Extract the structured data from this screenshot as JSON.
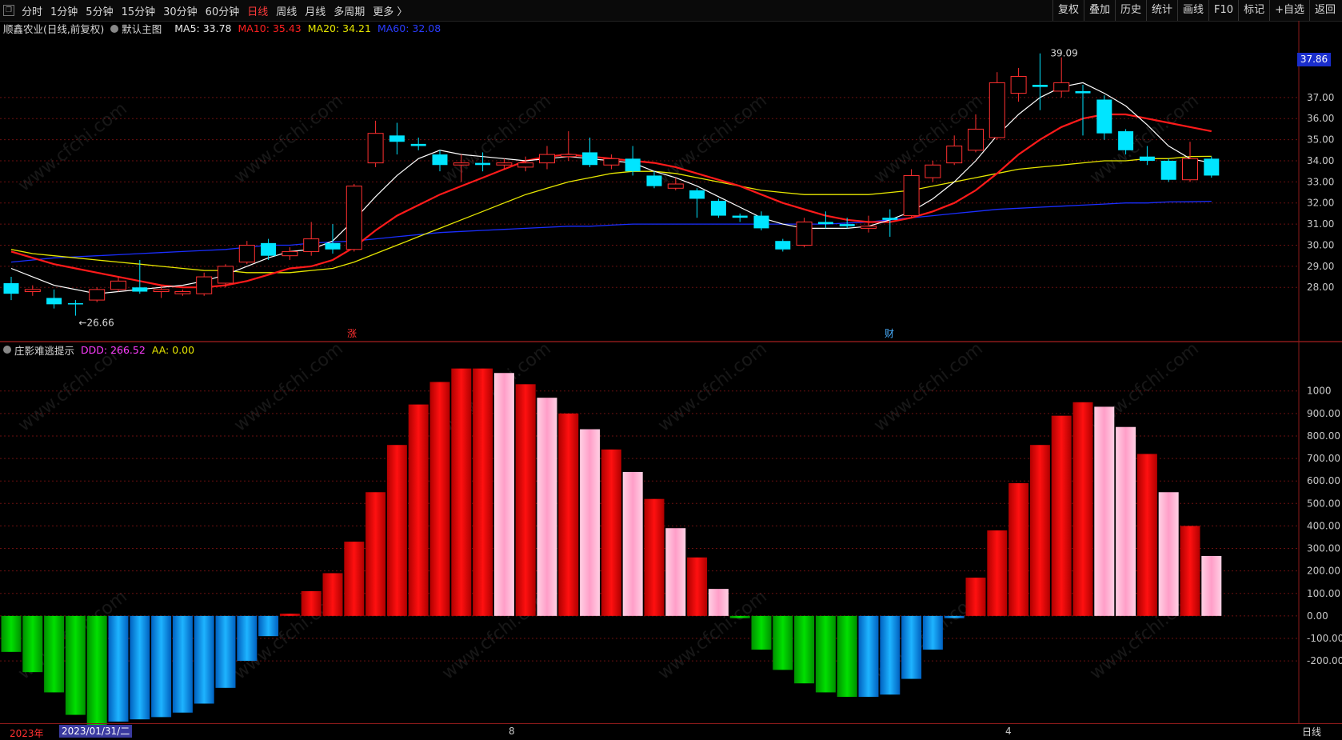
{
  "toolbar": {
    "window_icon": "restore-icon",
    "periods": [
      "分时",
      "1分钟",
      "5分钟",
      "15分钟",
      "30分钟",
      "60分钟",
      "日线",
      "周线",
      "月线",
      "多周期",
      "更多 〉"
    ],
    "active_period": "日线",
    "actions": [
      "复权",
      "叠加",
      "历史",
      "统计",
      "画线",
      "F10",
      "标记",
      "+自选",
      "返回"
    ]
  },
  "main_header": {
    "stock": "顺鑫农业(日线,前复权)",
    "template": "默认主图",
    "ma5": "MA5: 33.78",
    "ma10": "MA10: 35.43",
    "ma20": "MA20: 34.21",
    "ma60": "MA60: 32.08"
  },
  "indicator_header": {
    "name": "庄影难逃提示",
    "ddd": "DDD: 266.52",
    "aa": "AA: 0.00"
  },
  "current_price": "37.86",
  "annotations": {
    "high": "39.09",
    "low": "←26.66",
    "zhang": "涨",
    "cai": "财"
  },
  "bottom": {
    "year": "2023年",
    "date": "2023/01/31/二",
    "month8": "8",
    "month4": "4",
    "period_label": "日线"
  },
  "watermark": "www.cfchi.com",
  "colors": {
    "up": "#ff3030",
    "down": "#00e5ff",
    "ma5": "#ffffff",
    "ma10": "#ff1a1a",
    "ma20": "#e6e600",
    "ma60": "#1a2eff",
    "grid": "#6b1010",
    "bar_red": "#ff1010",
    "bar_pink": "#ff9ec8",
    "bar_green": "#00e000",
    "bar_blue": "#1eb4ff"
  },
  "chart_data": [
    {
      "type": "candlestick",
      "title": "顺鑫农业(日线,前复权)",
      "y_ticks": [
        "28.00",
        "29.00",
        "30.00",
        "31.00",
        "32.00",
        "33.00",
        "34.00",
        "35.00",
        "36.00",
        "37.00"
      ],
      "ylim": [
        26.0,
        39.8
      ],
      "candles": [
        {
          "o": 28.2,
          "c": 27.7,
          "h": 28.5,
          "l": 27.4
        },
        {
          "o": 27.8,
          "c": 27.9,
          "h": 28.1,
          "l": 27.6
        },
        {
          "o": 27.5,
          "c": 27.2,
          "h": 27.9,
          "l": 27.0
        },
        {
          "o": 27.25,
          "c": 27.2,
          "h": 27.4,
          "l": 26.66
        },
        {
          "o": 27.4,
          "c": 27.9,
          "h": 28.0,
          "l": 27.3
        },
        {
          "o": 27.9,
          "c": 28.3,
          "h": 28.5,
          "l": 27.8
        },
        {
          "o": 28.0,
          "c": 27.8,
          "h": 29.3,
          "l": 27.7
        },
        {
          "o": 27.8,
          "c": 27.9,
          "h": 28.1,
          "l": 27.5
        },
        {
          "o": 27.7,
          "c": 27.8,
          "h": 27.9,
          "l": 27.6
        },
        {
          "o": 27.7,
          "c": 28.5,
          "h": 28.7,
          "l": 27.6
        },
        {
          "o": 28.2,
          "c": 29.0,
          "h": 29.1,
          "l": 28.0
        },
        {
          "o": 29.2,
          "c": 30.0,
          "h": 30.2,
          "l": 29.1
        },
        {
          "o": 30.1,
          "c": 29.5,
          "h": 30.3,
          "l": 29.3
        },
        {
          "o": 29.5,
          "c": 29.7,
          "h": 29.9,
          "l": 29.3
        },
        {
          "o": 29.7,
          "c": 30.3,
          "h": 31.1,
          "l": 29.5
        },
        {
          "o": 30.1,
          "c": 29.8,
          "h": 31.0,
          "l": 29.6
        },
        {
          "o": 29.8,
          "c": 32.8,
          "h": 32.9,
          "l": 29.7
        },
        {
          "o": 33.9,
          "c": 35.3,
          "h": 35.9,
          "l": 33.7
        },
        {
          "o": 35.2,
          "c": 34.9,
          "h": 35.8,
          "l": 34.3
        },
        {
          "o": 34.8,
          "c": 34.7,
          "h": 35.1,
          "l": 34.5
        },
        {
          "o": 34.3,
          "c": 33.8,
          "h": 34.5,
          "l": 33.5
        },
        {
          "o": 33.8,
          "c": 33.9,
          "h": 34.3,
          "l": 33.0
        },
        {
          "o": 33.9,
          "c": 33.8,
          "h": 34.4,
          "l": 33.5
        },
        {
          "o": 33.8,
          "c": 33.9,
          "h": 34.1,
          "l": 33.6
        },
        {
          "o": 33.7,
          "c": 33.9,
          "h": 34.2,
          "l": 33.5
        },
        {
          "o": 33.9,
          "c": 34.3,
          "h": 34.7,
          "l": 33.6
        },
        {
          "o": 34.2,
          "c": 34.3,
          "h": 35.4,
          "l": 34.0
        },
        {
          "o": 34.4,
          "c": 33.8,
          "h": 35.1,
          "l": 33.7
        },
        {
          "o": 33.8,
          "c": 34.1,
          "h": 34.3,
          "l": 33.6
        },
        {
          "o": 34.1,
          "c": 33.5,
          "h": 34.7,
          "l": 33.3
        },
        {
          "o": 33.3,
          "c": 32.8,
          "h": 33.5,
          "l": 32.7
        },
        {
          "o": 32.7,
          "c": 32.9,
          "h": 33.2,
          "l": 32.6
        },
        {
          "o": 32.6,
          "c": 32.2,
          "h": 32.7,
          "l": 31.3
        },
        {
          "o": 32.1,
          "c": 31.4,
          "h": 32.2,
          "l": 31.3
        },
        {
          "o": 31.4,
          "c": 31.3,
          "h": 31.5,
          "l": 31.1
        },
        {
          "o": 31.4,
          "c": 30.8,
          "h": 31.6,
          "l": 30.7
        },
        {
          "o": 30.2,
          "c": 29.8,
          "h": 30.3,
          "l": 29.7
        },
        {
          "o": 30.0,
          "c": 31.1,
          "h": 31.3,
          "l": 29.9
        },
        {
          "o": 31.1,
          "c": 31.0,
          "h": 31.6,
          "l": 30.8
        },
        {
          "o": 31.0,
          "c": 30.9,
          "h": 31.3,
          "l": 30.8
        },
        {
          "o": 30.8,
          "c": 30.9,
          "h": 31.4,
          "l": 30.6
        },
        {
          "o": 31.3,
          "c": 31.2,
          "h": 31.7,
          "l": 30.4
        },
        {
          "o": 31.4,
          "c": 33.3,
          "h": 33.6,
          "l": 31.3
        },
        {
          "o": 33.2,
          "c": 33.8,
          "h": 34.0,
          "l": 33.0
        },
        {
          "o": 33.9,
          "c": 34.7,
          "h": 35.2,
          "l": 33.8
        },
        {
          "o": 34.5,
          "c": 35.5,
          "h": 36.2,
          "l": 34.4
        },
        {
          "o": 35.1,
          "c": 37.7,
          "h": 38.2,
          "l": 35.0
        },
        {
          "o": 37.2,
          "c": 38.0,
          "h": 38.4,
          "l": 36.8
        },
        {
          "o": 37.6,
          "c": 37.5,
          "h": 39.09,
          "l": 36.4
        },
        {
          "o": 37.3,
          "c": 37.7,
          "h": 38.9,
          "l": 37.0
        },
        {
          "o": 37.3,
          "c": 37.2,
          "h": 37.6,
          "l": 35.2
        },
        {
          "o": 36.9,
          "c": 35.3,
          "h": 37.1,
          "l": 35.0
        },
        {
          "o": 35.4,
          "c": 34.5,
          "h": 35.5,
          "l": 34.3
        },
        {
          "o": 34.2,
          "c": 34.0,
          "h": 34.7,
          "l": 33.8
        },
        {
          "o": 34.0,
          "c": 33.1,
          "h": 34.1,
          "l": 33.0
        },
        {
          "o": 33.1,
          "c": 34.1,
          "h": 34.9,
          "l": 33.0
        },
        {
          "o": 34.1,
          "c": 33.3,
          "h": 34.2,
          "l": 33.2
        }
      ],
      "ma5": [
        28.9,
        28.5,
        28.1,
        27.9,
        27.7,
        27.8,
        27.9,
        28.0,
        28.1,
        28.3,
        28.6,
        29.0,
        29.4,
        29.7,
        29.8,
        30.2,
        31.2,
        32.3,
        33.3,
        34.1,
        34.5,
        34.3,
        34.2,
        34.1,
        34.0,
        34.1,
        34.2,
        34.1,
        34.0,
        33.9,
        33.5,
        33.2,
        32.8,
        32.3,
        31.8,
        31.3,
        31.0,
        30.8,
        30.8,
        30.8,
        30.9,
        31.2,
        31.6,
        32.2,
        33.0,
        34.0,
        35.2,
        36.2,
        37.0,
        37.5,
        37.7,
        37.2,
        36.6,
        35.7,
        34.7,
        34.1,
        33.9
      ],
      "ma10": [
        29.7,
        29.4,
        29.1,
        28.9,
        28.7,
        28.5,
        28.3,
        28.1,
        28.0,
        28.0,
        28.1,
        28.3,
        28.6,
        28.9,
        29.0,
        29.3,
        29.9,
        30.7,
        31.4,
        31.9,
        32.4,
        32.8,
        33.2,
        33.6,
        34.0,
        34.2,
        34.3,
        34.2,
        34.1,
        34.0,
        33.9,
        33.7,
        33.4,
        33.1,
        32.8,
        32.4,
        32.0,
        31.7,
        31.4,
        31.2,
        31.1,
        31.1,
        31.3,
        31.6,
        32.0,
        32.6,
        33.4,
        34.3,
        35.0,
        35.6,
        36.0,
        36.2,
        36.2,
        36.0,
        35.8,
        35.6,
        35.4
      ],
      "ma20": [
        29.8,
        29.6,
        29.5,
        29.4,
        29.3,
        29.2,
        29.1,
        29.0,
        28.9,
        28.8,
        28.8,
        28.7,
        28.7,
        28.7,
        28.8,
        28.9,
        29.2,
        29.6,
        30.0,
        30.4,
        30.8,
        31.2,
        31.6,
        32.0,
        32.4,
        32.7,
        33.0,
        33.2,
        33.4,
        33.5,
        33.5,
        33.4,
        33.2,
        33.0,
        32.8,
        32.6,
        32.5,
        32.4,
        32.4,
        32.4,
        32.4,
        32.5,
        32.6,
        32.8,
        33.0,
        33.2,
        33.4,
        33.6,
        33.7,
        33.8,
        33.9,
        34.0,
        34.0,
        34.1,
        34.1,
        34.2,
        34.21
      ],
      "ma60": [
        29.2,
        29.3,
        29.4,
        29.45,
        29.5,
        29.55,
        29.6,
        29.65,
        29.7,
        29.75,
        29.8,
        29.9,
        30.0,
        30.0,
        30.1,
        30.15,
        30.2,
        30.3,
        30.4,
        30.5,
        30.6,
        30.65,
        30.7,
        30.75,
        30.8,
        30.85,
        30.9,
        30.9,
        30.95,
        31.0,
        31.0,
        31.0,
        31.0,
        31.0,
        31.0,
        31.0,
        31.0,
        31.0,
        31.0,
        31.05,
        31.1,
        31.2,
        31.3,
        31.4,
        31.5,
        31.6,
        31.7,
        31.75,
        31.8,
        31.85,
        31.9,
        31.95,
        32.0,
        32.0,
        32.05,
        32.06,
        32.08
      ]
    },
    {
      "type": "bar",
      "title": "庄影难逃提示",
      "y_ticks": [
        "-200.00",
        "-100.00",
        "0.00",
        "100.00",
        "200.00",
        "300.00",
        "400.00",
        "500.00",
        "600.00",
        "700.00",
        "800.00",
        "900.00",
        "1000"
      ],
      "ylim": [
        -470,
        1120
      ],
      "values": [
        -160,
        -250,
        -340,
        -440,
        -490,
        -470,
        -460,
        -450,
        -430,
        -390,
        -320,
        -200,
        -90,
        10,
        110,
        190,
        330,
        550,
        760,
        940,
        1040,
        1100,
        1100,
        1080,
        1030,
        970,
        900,
        830,
        740,
        640,
        520,
        390,
        260,
        120,
        -10,
        -150,
        -240,
        -300,
        -340,
        -360,
        -360,
        -350,
        -280,
        -150,
        -10,
        170,
        380,
        590,
        760,
        890,
        950,
        930,
        840,
        720,
        550,
        400,
        266.52
      ],
      "colors": [
        "g",
        "g",
        "g",
        "g",
        "g",
        "b",
        "b",
        "b",
        "b",
        "b",
        "b",
        "b",
        "b",
        "r",
        "r",
        "r",
        "r",
        "r",
        "r",
        "r",
        "r",
        "r",
        "r",
        "p",
        "r",
        "p",
        "r",
        "p",
        "r",
        "p",
        "r",
        "p",
        "r",
        "p",
        "g",
        "g",
        "g",
        "g",
        "g",
        "g",
        "b",
        "b",
        "b",
        "b",
        "b",
        "r",
        "r",
        "r",
        "r",
        "r",
        "r",
        "p",
        "p",
        "r",
        "p",
        "r",
        "p"
      ]
    }
  ]
}
